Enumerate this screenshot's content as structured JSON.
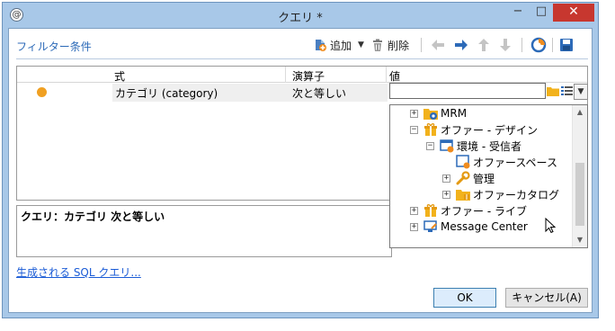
{
  "window": {
    "title": "クエリ *",
    "icon_glyph": "@",
    "minimize_glyph": "−",
    "maximize_glyph": "□",
    "close_glyph": "✕"
  },
  "toolbar": {
    "section_title": "フィルター条件",
    "add_label": "追加",
    "add_dropdown_glyph": "▼",
    "delete_label": "削除",
    "icons": [
      "add-filter-icon",
      "dropdown-arrow-icon",
      "trash-icon",
      "arrow-left-icon",
      "arrow-right-icon",
      "arrow-up-icon",
      "arrow-down-icon",
      "distribution-icon",
      "save-icon"
    ],
    "colors": {
      "section_title": "#2c6ab8",
      "arrow_active": "#2c6ab8",
      "arrow_disabled": "#c4c4c4"
    }
  },
  "grid": {
    "columns": [
      "式",
      "演算子",
      "値"
    ],
    "rows": [
      {
        "status_color": "#f0a022",
        "expression": "カテゴリ (category)",
        "operator": "次と等しい",
        "value": ""
      }
    ],
    "value_buttons": [
      "folder-icon",
      "list-icon",
      "chevron-down-icon"
    ]
  },
  "tree": {
    "items": [
      {
        "label": "MRM",
        "expander": "+",
        "icon": "mrm-folder-icon",
        "level": 0
      },
      {
        "label": "オファー - デザイン",
        "expander": "−",
        "icon": "offer-gift-icon",
        "level": 0
      },
      {
        "label": "環境 - 受信者",
        "expander": "−",
        "icon": "environment-icon",
        "level": 1
      },
      {
        "label": "オファースペース",
        "expander": "",
        "icon": "offer-space-icon",
        "level": 2
      },
      {
        "label": "管理",
        "expander": "+",
        "icon": "wrench-icon",
        "level": 2
      },
      {
        "label": "オファーカタログ",
        "expander": "+",
        "icon": "catalog-folder-icon",
        "level": 2
      },
      {
        "label": "オファー - ライブ",
        "expander": "+",
        "icon": "offer-gift-icon",
        "level": 0
      },
      {
        "label": "Message Center",
        "expander": "+",
        "icon": "message-center-icon",
        "level": 0
      }
    ],
    "scroll_up_glyph": "▲",
    "scroll_down_glyph": "▼"
  },
  "query": {
    "text": "クエリ：カテゴリ 次と等しい"
  },
  "links": {
    "sql": "生成される SQL クエリ..."
  },
  "buttons": {
    "ok": "OK",
    "cancel": "キャンセル(A)"
  }
}
